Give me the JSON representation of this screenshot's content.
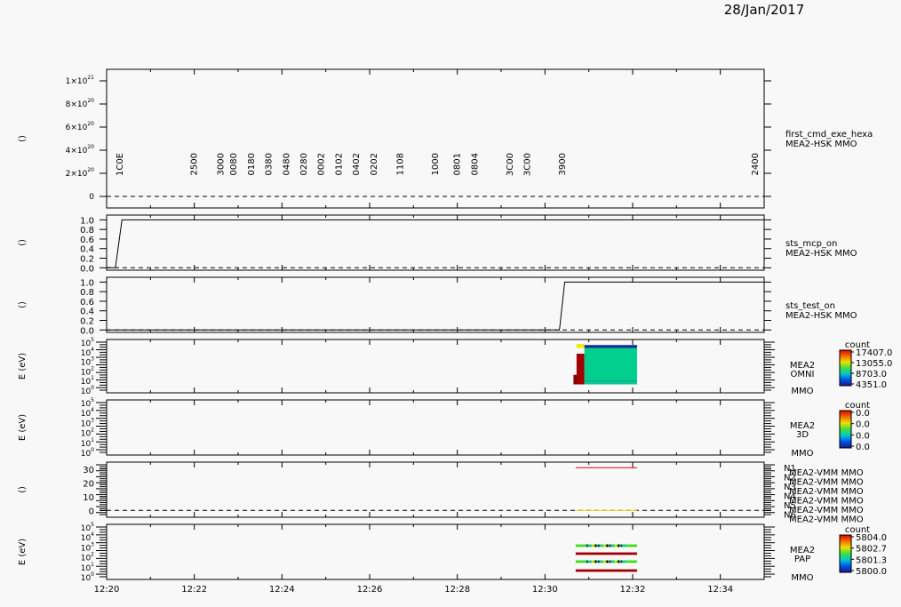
{
  "date": "28/Jan/2017",
  "time_axis": {
    "start": "12:20",
    "end": "12:35",
    "ticks": [
      "12:20",
      "12:22",
      "12:24",
      "12:26",
      "12:28",
      "12:30",
      "12:32",
      "12:34"
    ]
  },
  "chart_data": [
    {
      "type": "line",
      "ylabel": "()",
      "side_label": [
        "first_cmd_exe_hexa",
        "MEA2-HSK MMO"
      ],
      "yticks": [
        {
          "m": "0",
          "e": ""
        },
        {
          "m": "2×10",
          "e": "20"
        },
        {
          "m": "4×10",
          "e": "20"
        },
        {
          "m": "6×10",
          "e": "20"
        },
        {
          "m": "8×10",
          "e": "20"
        },
        {
          "m": "1×10",
          "e": "21"
        }
      ],
      "ylim": [
        -1e+20,
        1.1e+21
      ],
      "annotations": [
        {
          "t": "12:20.3",
          "text": "1C0E"
        },
        {
          "t": "12:22.0",
          "text": "2500"
        },
        {
          "t": "12:22.6",
          "text": "3000"
        },
        {
          "t": "12:22.9",
          "text": "0080"
        },
        {
          "t": "12:23.3",
          "text": "0180"
        },
        {
          "t": "12:23.7",
          "text": "0380"
        },
        {
          "t": "12:24.1",
          "text": "0480"
        },
        {
          "t": "12:24.5",
          "text": "0280"
        },
        {
          "t": "12:24.9",
          "text": "0002"
        },
        {
          "t": "12:25.3",
          "text": "0102"
        },
        {
          "t": "12:25.7",
          "text": "0402"
        },
        {
          "t": "12:26.1",
          "text": "0202"
        },
        {
          "t": "12:26.7",
          "text": "1108"
        },
        {
          "t": "12:27.5",
          "text": "1000"
        },
        {
          "t": "12:28.0",
          "text": "0801"
        },
        {
          "t": "12:28.4",
          "text": "0804"
        },
        {
          "t": "12:29.2",
          "text": "3C00"
        },
        {
          "t": "12:29.6",
          "text": "3C00"
        },
        {
          "t": "12:30.4",
          "text": "3900"
        },
        {
          "t": "12:34.8",
          "text": "2400"
        }
      ]
    },
    {
      "type": "line",
      "ylabel": "()",
      "side_label": [
        "sts_mcp_on",
        "MEA2-HSK MMO"
      ],
      "yticks": [
        "0.0",
        "0.2",
        "0.4",
        "0.6",
        "0.8",
        "1.0"
      ],
      "ylim": [
        -0.05,
        1.1
      ],
      "series": [
        {
          "x": [
            "12:20.0",
            "12:20.2",
            "12:20.35",
            "12:35"
          ],
          "y": [
            0,
            0,
            1,
            1
          ]
        }
      ]
    },
    {
      "type": "line",
      "ylabel": "()",
      "side_label": [
        "sts_test_on",
        "MEA2-HSK MMO"
      ],
      "yticks": [
        "0.0",
        "0.2",
        "0.4",
        "0.6",
        "0.8",
        "1.0"
      ],
      "ylim": [
        -0.05,
        1.1
      ],
      "series": [
        {
          "x": [
            "12:20.0",
            "12:30.33",
            "12:30.45",
            "12:35"
          ],
          "y": [
            0,
            0,
            1,
            1
          ]
        }
      ]
    },
    {
      "type": "heatmap",
      "ylabel": "E (eV)",
      "side_label": [
        "MEA2",
        "OMNI",
        "MMO"
      ],
      "colorbar": {
        "title": "count",
        "ticks": [
          "17407.0",
          "13055.0",
          "8703.0",
          "4351.0"
        ]
      },
      "yticks": [
        {
          "m": "10",
          "e": "0"
        },
        {
          "m": "10",
          "e": "1"
        },
        {
          "m": "10",
          "e": "2"
        },
        {
          "m": "10",
          "e": "3"
        },
        {
          "m": "10",
          "e": "4"
        },
        {
          "m": "10",
          "e": "5"
        }
      ],
      "blocks": [
        {
          "t0": "12:30.65",
          "t1": "12:30.75",
          "e0": 0.6,
          "e1": 1.6,
          "color": "#8b0000"
        },
        {
          "t0": "12:30.72",
          "t1": "12:30.9",
          "e0": 0.6,
          "e1": 3.8,
          "color": "#a00000"
        },
        {
          "t0": "12:30.72",
          "t1": "12:30.9",
          "e0": 4.4,
          "e1": 4.8,
          "color": "#f4e800"
        },
        {
          "t0": "12:30.9",
          "t1": "12:32.1",
          "e0": 0.6,
          "e1": 4.6,
          "color": "#00d08c"
        },
        {
          "t0": "12:30.9",
          "t1": "12:32.1",
          "e0": 4.4,
          "e1": 4.7,
          "color": "#1a2a9a"
        },
        {
          "t0": "12:30.9",
          "t1": "12:32.1",
          "e0": 0.9,
          "e1": 1.0,
          "color": "#2a8ab0"
        }
      ]
    },
    {
      "type": "heatmap",
      "ylabel": "E (eV)",
      "side_label": [
        "MEA2",
        "3D",
        "MMO"
      ],
      "colorbar": {
        "title": "count",
        "ticks": [
          "0.0",
          "0.0",
          "0.0",
          "0.0"
        ]
      },
      "yticks": [
        {
          "m": "10",
          "e": "0"
        },
        {
          "m": "10",
          "e": "1"
        },
        {
          "m": "10",
          "e": "2"
        },
        {
          "m": "10",
          "e": "3"
        },
        {
          "m": "10",
          "e": "4"
        },
        {
          "m": "10",
          "e": "5"
        }
      ],
      "blocks": []
    },
    {
      "type": "line",
      "ylabel": "()",
      "yticks": [
        "0",
        "10",
        "20",
        "30"
      ],
      "ylim": [
        -5,
        35
      ],
      "legend": [
        {
          "tag": "N1",
          "label": "MEA2-VMM MMO",
          "color": "#e00000"
        },
        {
          "tag": "N2",
          "label": "MEA2-VMM MMO",
          "color": "#00c000"
        },
        {
          "tag": "N3",
          "label": "MEA2-VMM MMO",
          "color": "#0000e0"
        },
        {
          "tag": "N4",
          "label": "MEA2-VMM MMO",
          "color": "#000000"
        },
        {
          "tag": "N5",
          "label": "MEA2-VMM MMO",
          "color": "#e000e0"
        },
        {
          "tag": "N6",
          "label": "MEA2-VMM MMO",
          "color": "#e8e000"
        }
      ],
      "series": [
        {
          "x": [
            "12:30.7",
            "12:32.1"
          ],
          "y": [
            31,
            31
          ],
          "color": "#e00000"
        },
        {
          "x": [
            "12:30.7",
            "12:32.1"
          ],
          "y": [
            0,
            0
          ],
          "color": "#e8e000"
        }
      ]
    },
    {
      "type": "heatmap",
      "ylabel": "E (eV)",
      "side_label": [
        "MEA2",
        "PAP",
        "MMO"
      ],
      "colorbar": {
        "title": "count",
        "ticks": [
          "5804.0",
          "5802.7",
          "5801.3",
          "5800.0"
        ]
      },
      "yticks": [
        {
          "m": "10",
          "e": "0"
        },
        {
          "m": "10",
          "e": "1"
        },
        {
          "m": "10",
          "e": "2"
        },
        {
          "m": "10",
          "e": "3"
        },
        {
          "m": "10",
          "e": "4"
        },
        {
          "m": "10",
          "e": "5"
        }
      ],
      "blocks": [
        {
          "t0": "12:30.7",
          "t1": "12:32.1",
          "e0": 3.0,
          "e1": 3.25,
          "color": "#40dc20",
          "striped": true
        },
        {
          "t0": "12:30.7",
          "t1": "12:32.1",
          "e0": 2.2,
          "e1": 2.45,
          "color": "#a00000"
        },
        {
          "t0": "12:30.7",
          "t1": "12:32.1",
          "e0": 1.4,
          "e1": 1.65,
          "color": "#40dc20",
          "striped": true
        },
        {
          "t0": "12:30.7",
          "t1": "12:32.1",
          "e0": 0.5,
          "e1": 0.75,
          "color": "#a00000"
        }
      ]
    }
  ]
}
